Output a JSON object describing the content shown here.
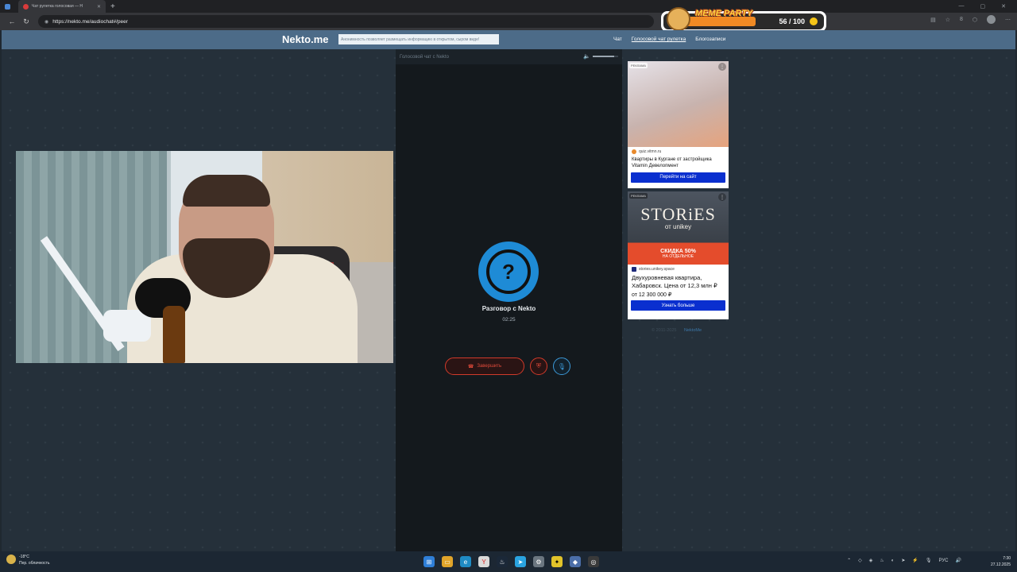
{
  "browser": {
    "tab_title": "Чат рулетка голосовая — Н",
    "url": "https://nekto.me/audiochat#/peer",
    "new_tab": "+",
    "extensions_count": "8"
  },
  "overlay": {
    "title": "MEME PARTY",
    "score": "56 / 100"
  },
  "site": {
    "logo": "Nekto.me",
    "notice": "Анонимность позволяет размещать информацию в открытом, сыром виде!",
    "nav": [
      "Чат",
      "Голосовой чат рулетка",
      "Блогозаписи"
    ]
  },
  "chat": {
    "header": "Голосовой чат с Nekto",
    "avatar_symbol": "?",
    "peer_name": "Разговор с Nekto",
    "timer": "02:25",
    "end_button": "Завершить",
    "volume_level": 0.85
  },
  "ads": [
    {
      "label": "РЕКЛАМА",
      "domain": "quiz.vitmn.ru",
      "title": "Квартиры в Кургане от застройщика Vitamin Девелопмент",
      "button": "Перейти на сайт"
    },
    {
      "label": "РЕКЛАМА",
      "brand": "STORiES",
      "brand_sub": "от unikey",
      "discount": "СКИДКА 50%",
      "discount_sub": "НА ОТДЕЛЬНОЕ",
      "domain": "stories.unikey.space",
      "title": "Двухуровневая квартира, Хабаровск. Цена от 12,3 млн ₽",
      "price": "от 12 300 000 ₽",
      "button": "Узнать больше"
    }
  ],
  "footer": {
    "copyright": "© 2011-2025",
    "link": "NektoMe"
  },
  "taskbar": {
    "temperature": "-18°C",
    "weather": "Пер. облачность",
    "language": "РУС",
    "time": "7:30",
    "date": "27.12.2025"
  }
}
